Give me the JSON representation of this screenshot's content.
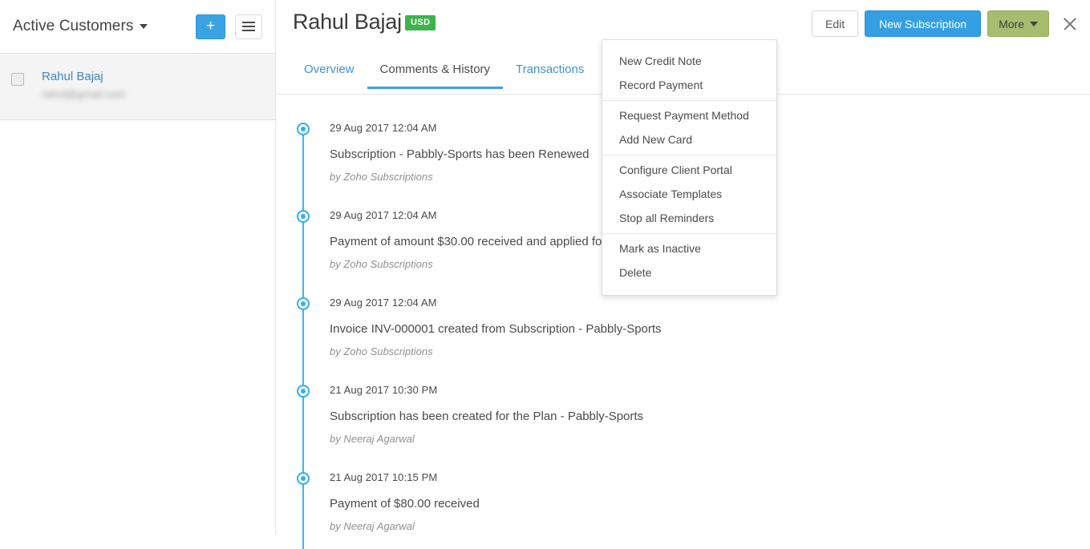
{
  "sidebar": {
    "list_selector_label": "Active Customers",
    "add_button_label": "+",
    "customers": [
      {
        "name": "Rahul Bajaj",
        "email": "rahul@gmail.com"
      }
    ]
  },
  "header": {
    "title": "Rahul Bajaj",
    "currency_badge": "USD",
    "edit_label": "Edit",
    "new_subscription_label": "New Subscription",
    "more_label": "More"
  },
  "tabs": [
    {
      "label": "Overview",
      "active": false
    },
    {
      "label": "Comments & History",
      "active": true
    },
    {
      "label": "Transactions",
      "active": false
    }
  ],
  "timeline": [
    {
      "date": "29 Aug 2017 12:04 AM",
      "description": "Subscription - Pabbly-Sports has been Renewed",
      "author": "by Zoho Subscriptions"
    },
    {
      "date": "29 Aug 2017 12:04 AM",
      "description": "Payment of amount $30.00 received and applied for INV-000001",
      "author": "by Zoho Subscriptions"
    },
    {
      "date": "29 Aug 2017 12:04 AM",
      "description": "Invoice INV-000001 created from Subscription - Pabbly-Sports",
      "author": "by Zoho Subscriptions"
    },
    {
      "date": "21 Aug 2017 10:30 PM",
      "description": "Subscription has been created for the Plan - Pabbly-Sports",
      "author": "by Neeraj Agarwal"
    },
    {
      "date": "21 Aug 2017 10:15 PM",
      "description": "Payment of $80.00 received",
      "author": "by Neeraj Agarwal"
    }
  ],
  "more_menu": {
    "groups": [
      {
        "items": [
          "New Credit Note",
          "Record Payment"
        ]
      },
      {
        "items": [
          "Request Payment Method",
          "Add New Card"
        ]
      },
      {
        "items": [
          "Configure Client Portal",
          "Associate Templates",
          "Stop all Reminders"
        ]
      },
      {
        "items": [
          "Mark as Inactive",
          "Delete"
        ]
      }
    ]
  },
  "colors": {
    "accent_blue": "#349fe2",
    "badge_green": "#3cb44a",
    "more_olive": "#a6bd6f",
    "timeline_blue": "#2eb0ed",
    "link_blue": "#3f85c6"
  }
}
